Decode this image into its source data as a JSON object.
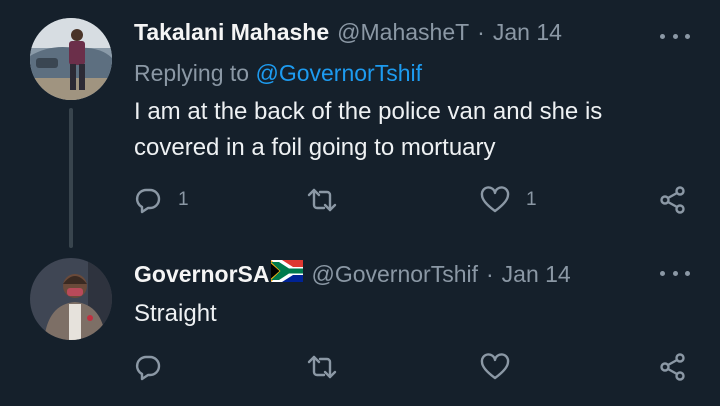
{
  "tweets": [
    {
      "display_name": "Takalani Mahashe",
      "handle": "@MahasheT",
      "separator": "·",
      "time": "Jan 14",
      "replying_prefix": "Replying to",
      "replying_handle": "@GovernorTshif",
      "text": "I am at the back of the police van and she is covered in a foil going to mortuary",
      "reply_count": "1",
      "retweet_count": "",
      "like_count": "1"
    },
    {
      "display_name": "GovernorSA",
      "flag_icon": "south-africa-flag-icon",
      "handle": "@GovernorTshif",
      "separator": "·",
      "time": "Jan 14",
      "text": "Straight",
      "reply_count": "",
      "retweet_count": "",
      "like_count": ""
    }
  ],
  "icons": {
    "more": "more-horizontal-icon",
    "reply": "speech-bubble-icon",
    "retweet": "retweet-icon",
    "like": "heart-icon",
    "share": "share-icon"
  },
  "colors": {
    "background": "#15202b",
    "link": "#1d9bf0",
    "muted": "#8b98a5",
    "text": "#eef1f3"
  }
}
